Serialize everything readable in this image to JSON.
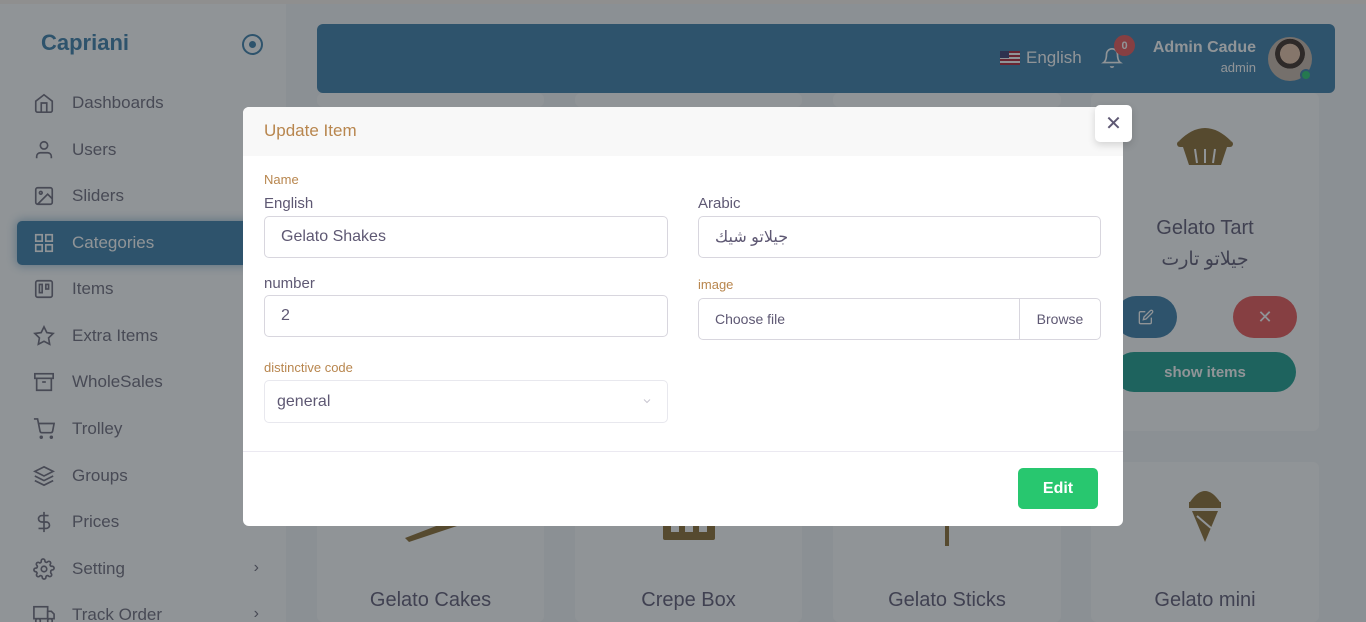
{
  "sidebar": {
    "brand": "Capriani",
    "items": [
      {
        "label": "Dashboards",
        "icon": "home-icon"
      },
      {
        "label": "Users",
        "icon": "user-icon"
      },
      {
        "label": "Sliders",
        "icon": "image-icon"
      },
      {
        "label": "Categories",
        "icon": "grid-icon",
        "active": true
      },
      {
        "label": "Items",
        "icon": "trello-icon"
      },
      {
        "label": "Extra Items",
        "icon": "star-icon"
      },
      {
        "label": "WholeSales",
        "icon": "archive-icon"
      },
      {
        "label": "Trolley",
        "icon": "shopping-cart-icon"
      },
      {
        "label": "Groups",
        "icon": "layers-icon"
      },
      {
        "label": "Prices",
        "icon": "dollar-sign-icon"
      },
      {
        "label": "Setting",
        "icon": "settings-icon",
        "chevron": "›"
      },
      {
        "label": "Track Order",
        "icon": "truck-icon",
        "chevron": "›"
      }
    ]
  },
  "header": {
    "language": "English",
    "notification_count": "0",
    "user_name": "Admin Cadue",
    "user_role": "admin"
  },
  "cards": [
    {
      "title": "Gelato Tart",
      "subtitle": "جيلاتو تارت",
      "show_label": "show items",
      "delete_glyph": "✕"
    },
    {
      "title": "Gelato Cakes"
    },
    {
      "title": "Crepe Box"
    },
    {
      "title": "Gelato Sticks"
    },
    {
      "title": "Gelato mini"
    }
  ],
  "modal": {
    "title": "Update Item",
    "close_glyph": "✕",
    "name_section": "Name",
    "english_label": "English",
    "english_value": "Gelato Shakes",
    "arabic_label": "Arabic",
    "arabic_value": "جيلاتو شيك",
    "number_label": "number",
    "number_value": "2",
    "image_label": "image",
    "file_placeholder": "Choose file",
    "file_button": "Browse",
    "code_label": "distinctive code",
    "code_value": "general",
    "submit_label": "Edit"
  },
  "colors": {
    "primary": "#3a7ca8",
    "gold": "#b8864e",
    "success": "#28c76f",
    "danger": "#ea5455",
    "teal": "#1a9c8c",
    "overlay": "rgba(34,41,47,0.5)"
  }
}
